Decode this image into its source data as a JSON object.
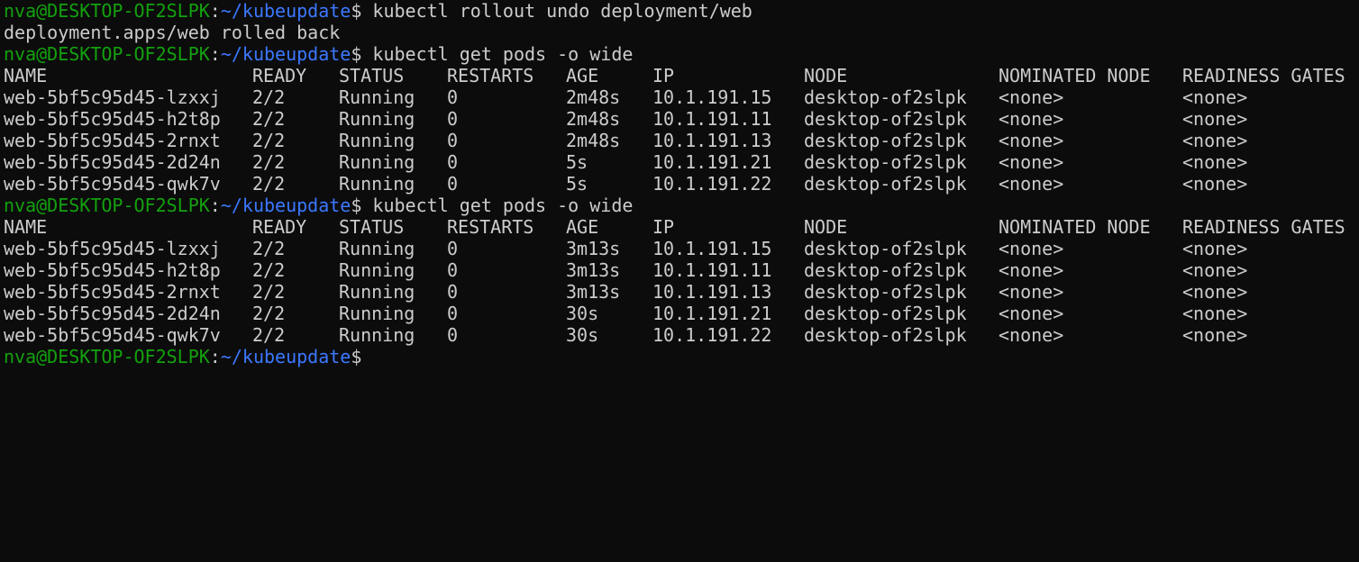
{
  "prompt": {
    "user": "nva@DESKTOP-OF2SLPK",
    "sep": ":",
    "path": "~/kubeupdate",
    "sigil": "$"
  },
  "blocks": [
    {
      "command": " kubectl rollout undo deployment/web",
      "output": "deployment.apps/web rolled back"
    },
    {
      "command": " kubectl get pods -o wide",
      "headers": [
        "NAME",
        "READY",
        "STATUS",
        "RESTARTS",
        "AGE",
        "IP",
        "NODE",
        "NOMINATED NODE",
        "READINESS GATES"
      ],
      "rows": [
        [
          "web-5bf5c95d45-lzxxj",
          "2/2",
          "Running",
          "0",
          "2m48s",
          "10.1.191.15",
          "desktop-of2slpk",
          "<none>",
          "<none>"
        ],
        [
          "web-5bf5c95d45-h2t8p",
          "2/2",
          "Running",
          "0",
          "2m48s",
          "10.1.191.11",
          "desktop-of2slpk",
          "<none>",
          "<none>"
        ],
        [
          "web-5bf5c95d45-2rnxt",
          "2/2",
          "Running",
          "0",
          "2m48s",
          "10.1.191.13",
          "desktop-of2slpk",
          "<none>",
          "<none>"
        ],
        [
          "web-5bf5c95d45-2d24n",
          "2/2",
          "Running",
          "0",
          "5s",
          "10.1.191.21",
          "desktop-of2slpk",
          "<none>",
          "<none>"
        ],
        [
          "web-5bf5c95d45-qwk7v",
          "2/2",
          "Running",
          "0",
          "5s",
          "10.1.191.22",
          "desktop-of2slpk",
          "<none>",
          "<none>"
        ]
      ]
    },
    {
      "command": " kubectl get pods -o wide",
      "headers": [
        "NAME",
        "READY",
        "STATUS",
        "RESTARTS",
        "AGE",
        "IP",
        "NODE",
        "NOMINATED NODE",
        "READINESS GATES"
      ],
      "rows": [
        [
          "web-5bf5c95d45-lzxxj",
          "2/2",
          "Running",
          "0",
          "3m13s",
          "10.1.191.15",
          "desktop-of2slpk",
          "<none>",
          "<none>"
        ],
        [
          "web-5bf5c95d45-h2t8p",
          "2/2",
          "Running",
          "0",
          "3m13s",
          "10.1.191.11",
          "desktop-of2slpk",
          "<none>",
          "<none>"
        ],
        [
          "web-5bf5c95d45-2rnxt",
          "2/2",
          "Running",
          "0",
          "3m13s",
          "10.1.191.13",
          "desktop-of2slpk",
          "<none>",
          "<none>"
        ],
        [
          "web-5bf5c95d45-2d24n",
          "2/2",
          "Running",
          "0",
          "30s",
          "10.1.191.21",
          "desktop-of2slpk",
          "<none>",
          "<none>"
        ],
        [
          "web-5bf5c95d45-qwk7v",
          "2/2",
          "Running",
          "0",
          "30s",
          "10.1.191.22",
          "desktop-of2slpk",
          "<none>",
          "<none>"
        ]
      ]
    }
  ],
  "colors": {
    "background": "#0c0c0c",
    "text": "#cccccc",
    "user": "#13a10e",
    "path": "#3b78ff"
  }
}
